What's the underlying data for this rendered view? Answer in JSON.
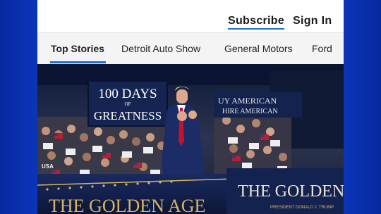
{
  "header": {
    "subscribe_label": "Subscribe",
    "signin_label": "Sign In"
  },
  "tabs": [
    {
      "label": "Top Stories",
      "active": true
    },
    {
      "label": "Detroit Auto Show",
      "active": false
    },
    {
      "label": "General Motors",
      "active": false
    },
    {
      "label": "Ford",
      "active": false
    }
  ],
  "hero": {
    "sign_line1": "100 DAYS",
    "sign_line2": "OF",
    "sign_line3": "GREATNESS",
    "banner_back": "UY AMERICAN",
    "banner_back2": "HIRE AMERICAN",
    "stage_left_text": "THE GOLDEN AGE",
    "stage_right_text": "THE GOLDEN AGE",
    "stage_right_sub": "PRESIDENT DONALD J. TRUMP",
    "crowd_sign": "USA"
  },
  "colors": {
    "accent": "#1f6fd1",
    "frame": "#0a2fa8",
    "stage_navy": "#14224f",
    "gold": "#d8b560",
    "tie_red": "#c4122f"
  }
}
